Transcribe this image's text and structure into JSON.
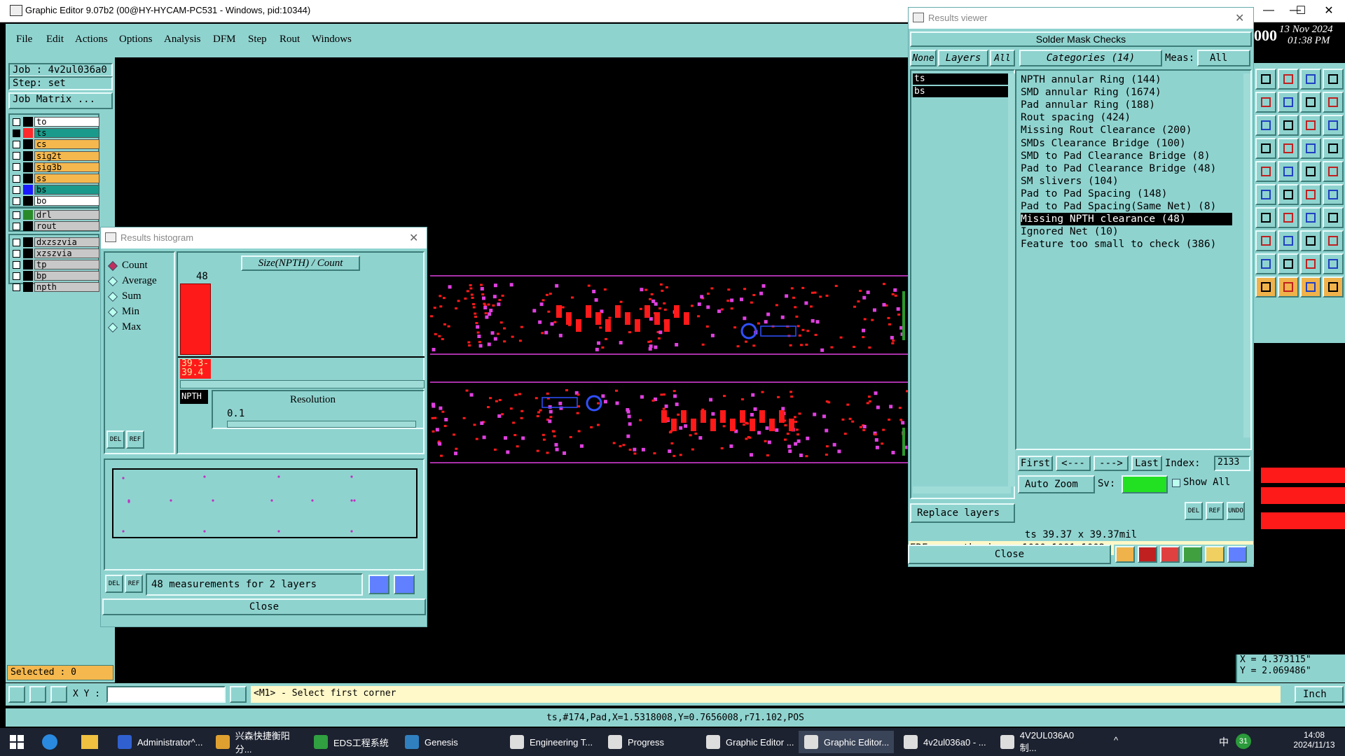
{
  "window": {
    "title": "Graphic Editor 9.07b2 (00@HY-HYCAM-PC531 - Windows, pid:10344)",
    "controls": [
      "—",
      "☐",
      "✕"
    ]
  },
  "menu": [
    "File",
    "Edit",
    "Actions",
    "Options",
    "Analysis",
    "DFM",
    "Step",
    "Rout",
    "Windows"
  ],
  "left": {
    "job": "Job : 4v2ul036a0",
    "step": "Step: set",
    "job_matrix": "Job Matrix ...",
    "layers": [
      {
        "name": "to",
        "color": "#ffffff",
        "swatch": "#000000",
        "checked": false
      },
      {
        "name": "ts",
        "color": "#1a9a8a",
        "swatch": "#ff2a2a",
        "checked": true
      },
      {
        "name": "cs",
        "color": "#f5b84e",
        "swatch": "#000000",
        "checked": false
      },
      {
        "name": "sig2t",
        "color": "#f5b84e",
        "swatch": "#000000",
        "checked": false
      },
      {
        "name": "sig3b",
        "color": "#f5b84e",
        "swatch": "#000000",
        "checked": false
      },
      {
        "name": "ss",
        "color": "#f5b84e",
        "swatch": "#000000",
        "checked": false
      },
      {
        "name": "bs",
        "color": "#1a9a8a",
        "swatch": "#1a1aff",
        "checked": false
      },
      {
        "name": "bo",
        "color": "#ffffff",
        "swatch": "#000000",
        "checked": false
      }
    ],
    "drill_layers": [
      {
        "name": "drl",
        "color": "#c8c8c8",
        "swatch": "#2a8a2a"
      },
      {
        "name": "rout",
        "color": "#c8c8c8",
        "swatch": "#000000"
      }
    ],
    "other_layers": [
      {
        "name": "dxzszvia",
        "color": "#c8c8c8"
      },
      {
        "name": "xzszvia",
        "color": "#c8c8c8"
      },
      {
        "name": "tp",
        "color": "#c8c8c8"
      },
      {
        "name": "bp",
        "color": "#c8c8c8"
      },
      {
        "name": "npth",
        "color": "#c8c8c8"
      }
    ],
    "selected": "Selected : 0"
  },
  "histogram": {
    "title": "Results histogram",
    "modes": [
      {
        "label": "Count",
        "on": true
      },
      {
        "label": "Average",
        "on": false
      },
      {
        "label": "Sum",
        "on": false
      },
      {
        "label": "Min",
        "on": false
      },
      {
        "label": "Max",
        "on": false
      }
    ],
    "chart_title": "Size(NPTH) / Count",
    "bar_value": "48",
    "bar_label_1": "39.3-",
    "bar_label_2": "39.4",
    "tag": "NPTH",
    "resolution_label": "Resolution",
    "resolution_value": "0.1",
    "del": "DEL",
    "ref": "REF",
    "summary": "48 measurements for 2 layers",
    "close": "Close"
  },
  "results": {
    "title": "Results viewer",
    "header": "Solder Mask Checks",
    "none": "None",
    "layers": "Layers",
    "all": "All",
    "categories": "Categories (14)",
    "meas_label": "Meas:",
    "meas_value": "All",
    "layer_list": [
      "ts",
      "bs"
    ],
    "items": [
      "NPTH annular Ring (144)",
      "SMD annular Ring (1674)",
      "Pad annular Ring (188)",
      "Rout spacing (424)",
      "Missing Rout Clearance (200)",
      "SMDs Clearance Bridge (100)",
      "SMD to Pad Clearance Bridge (8)",
      "Pad to Pad Clearance Bridge (48)",
      "SM slivers (104)",
      "Pad to Pad Spacing (148)",
      "Pad to Pad Spacing(Same Net) (8)",
      "Missing NPTH clearance (48)",
      "Ignored Net (10)",
      "Feature too small to check (386)"
    ],
    "selected_index": 11,
    "nav_first": "First",
    "nav_prev": "<---",
    "nav_next": "--->",
    "nav_last": "Last",
    "index_label": "Index:",
    "index_value": "2133",
    "auto_zoom": "Auto Zoom",
    "sv_label": "Sv:",
    "show_all": "Show All",
    "replace": "Replace layers",
    "del": "DEL",
    "ref": "REF",
    "undo": "UNDO",
    "size_info": "ts 39.37 x 39.37mil",
    "erf": "ERF--> npth_miss = 1000 1001 1002",
    "close": "Close"
  },
  "clock": {
    "fragment": "000",
    "date": "13 Nov 2024",
    "time": "01:38 PM"
  },
  "coords": {
    "x": "X = 4.373115\"",
    "y": "Y = 2.069486\""
  },
  "status": {
    "xy_label": "X Y :",
    "hint": "<M1> - Select first corner",
    "units": "Inch",
    "info": "ts,#174,Pad,X=1.5318008,Y=0.7656008,r71.102,POS"
  },
  "taskbar": {
    "apps": [
      "Administrator^...",
      "兴森快捷衡阳分...",
      "EDS工程系统",
      "Genesis",
      "Engineering T...",
      "Progress",
      "Graphic Editor ...",
      "Graphic Editor...",
      "4v2ul036a0 - ...",
      "4V2UL036A0制..."
    ],
    "ime": "中",
    "time": "14:08",
    "date": "2024/11/13",
    "badge": "31"
  }
}
